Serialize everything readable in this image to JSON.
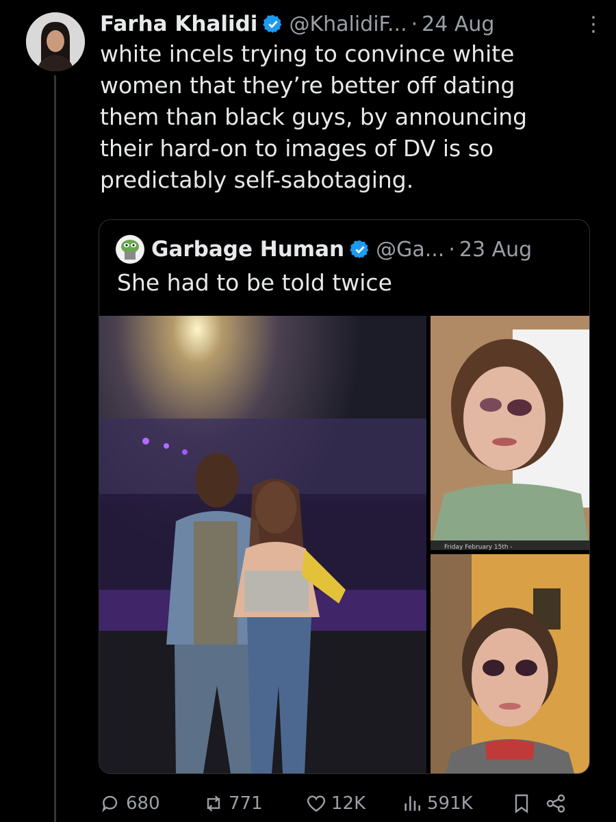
{
  "tweet": {
    "author_name": "Farha Khalidi",
    "handle": "@KhalidiF...",
    "separator": "·",
    "time": "24 Aug",
    "text": "white incels trying to convince white\nwomen that they’re better off dating\nthem than black guys, by announcing\ntheir hard-on to images of DV is so\npredictably self-sabotaging."
  },
  "quoted": {
    "author_name": "Garbage Human",
    "handle": "@Ga...",
    "separator": "·",
    "time": "23 Aug",
    "text": "She had to be told twice",
    "photo_caption": "Friday  February 15th -"
  },
  "actions": {
    "replies": "680",
    "reposts": "771",
    "likes": "12K",
    "views": "591K"
  },
  "colors": {
    "background": "#000000",
    "text": "#e7e9ea",
    "secondary": "#9aa0a6",
    "verified": "#1d9bf0",
    "border": "#2f3336"
  },
  "icons": [
    "verified-badge-icon",
    "more-icon",
    "reply-icon",
    "repost-icon",
    "like-icon",
    "views-icon",
    "bookmark-icon",
    "share-icon"
  ]
}
